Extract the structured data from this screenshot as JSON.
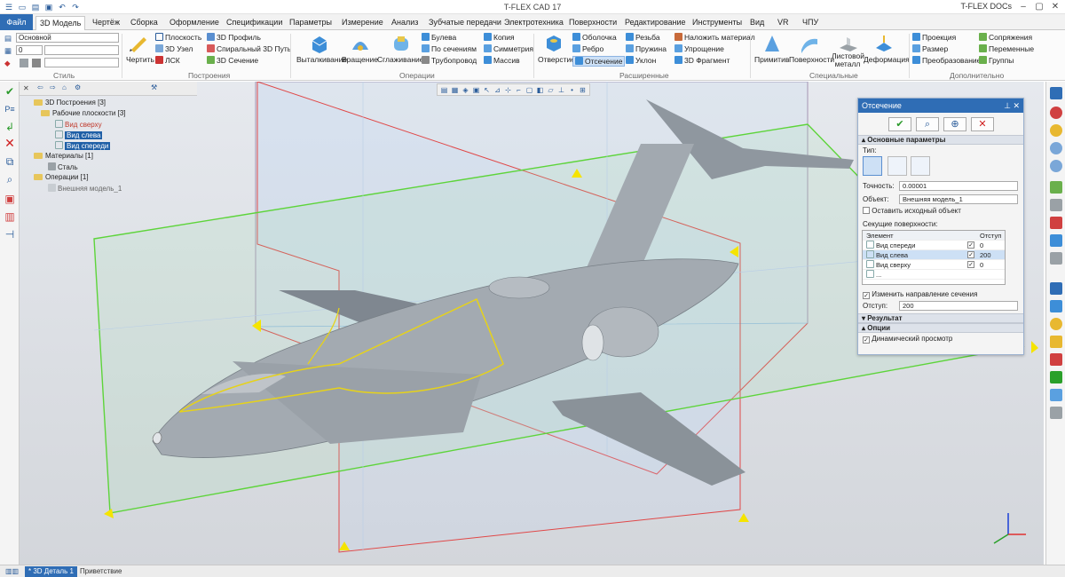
{
  "app": {
    "title": "T-FLEX CAD 17",
    "docs_label": "T-FLEX DOCs"
  },
  "tabs": [
    "Файл",
    "3D Модель",
    "Чертёж",
    "Сборка",
    "Оформление",
    "Спецификации",
    "Параметры",
    "Измерение",
    "Анализ",
    "Зубчатые передачи",
    "Электротехника",
    "Поверхности",
    "Редактирование",
    "Инструменты",
    "Вид",
    "VR",
    "ЧПУ"
  ],
  "ribbon": {
    "style": {
      "layer": "Основной",
      "value": "0",
      "label": "Стиль"
    },
    "build": {
      "draw": "Чертить",
      "plane": "Плоскость",
      "node": "3D Узел",
      "lsk": "ЛСК",
      "profile": "3D Профиль",
      "spiral": "Спиральный 3D Путь",
      "section": "3D Сечение",
      "label": "Построения"
    },
    "ops": {
      "extrude": "Выталкивание",
      "rotate": "Вращение",
      "smooth": "Сглаживание",
      "bool": "Булева",
      "by_sections": "По сечениям",
      "pipe": "Трубопровод",
      "copy": "Копия",
      "symmetry": "Симметрия",
      "array": "Массив",
      "label": "Операции"
    },
    "ext": {
      "hole": "Отверстие",
      "shell": "Оболочка",
      "rib": "Ребро",
      "cut": "Отсечение",
      "thread": "Резьба",
      "spring": "Пружина",
      "slope": "Уклон",
      "material": "Наложить материал",
      "simplify": "Упрощение",
      "fragment": "3D Фрагмент",
      "label": "Расширенные"
    },
    "spec": {
      "primitives": "Примитив",
      "surfaces": "Поверхности",
      "sheet": "Листовой металл",
      "deform": "Деформация",
      "label": "Специальные"
    },
    "extra": {
      "projection": "Проекция",
      "dimension": "Размер",
      "transform": "Преобразование",
      "mates": "Сопряжения",
      "variables": "Переменные",
      "groups": "Группы",
      "label": "Дополнительно"
    }
  },
  "tree": {
    "root": "3D Построения [3]",
    "workplanes": "Рабочие плоскости [3]",
    "planes": [
      "Вид сверху",
      "Вид слева",
      "Вид спереди"
    ],
    "materials": "Материалы [1]",
    "steel": "Сталь",
    "operations": "Операции [1]",
    "ext_model": "Внешняя модель_1"
  },
  "panel": {
    "title": "Отсечение",
    "main_params": "Основные параметры",
    "type_label": "Тип:",
    "accuracy_label": "Точность:",
    "accuracy": "0.00001",
    "object_label": "Объект:",
    "object": "Внешняя модель_1",
    "keep_source": "Оставить исходный объект",
    "cutting_surfaces": "Секущие поверхности:",
    "col_element": "Элемент",
    "col_offset": "Отступ",
    "rows": [
      {
        "name": "Вид спереди",
        "offset": "0"
      },
      {
        "name": "Вид слева",
        "offset": "200"
      },
      {
        "name": "Вид сверху",
        "offset": "0"
      },
      {
        "name": "...",
        "offset": ""
      }
    ],
    "change_dir": "Изменить направление сечения",
    "offset_label": "Отступ:",
    "offset": "200",
    "result": "Результат",
    "options": "Опции",
    "dynamic_view": "Динамический просмотр"
  },
  "status": {
    "doc_tab": "* 3D Деталь 1",
    "welcome": "Приветствие"
  },
  "colors": {
    "accent": "#2f6db5",
    "plane_green": "#5dd43a",
    "plane_red": "#e04848",
    "cut_yellow": "#e6d21a",
    "model_gray": "#9aa1a6"
  }
}
